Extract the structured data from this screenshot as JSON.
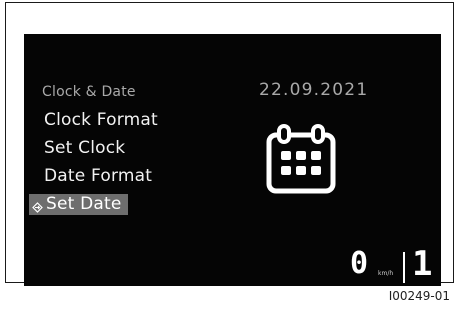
{
  "screen": {
    "section_title": "Clock & Date",
    "date_value": "22.09.2021",
    "menu_items": [
      {
        "label": "Clock Format",
        "selected": false
      },
      {
        "label": "Set Clock",
        "selected": false
      },
      {
        "label": "Date Format",
        "selected": false
      },
      {
        "label": "Set Date",
        "selected": true
      }
    ],
    "selection_icon": "diamond-arrow-icon",
    "calendar_icon": "calendar-icon",
    "speed": {
      "value": "0",
      "unit": "km/h"
    },
    "gear": "1"
  },
  "figure_id": "I00249-01",
  "colors": {
    "screen_background": "#050505",
    "dim_text": "#a9a9a9",
    "menu_text": "#f2f2f2",
    "selection_highlight": "#6e6e6e"
  }
}
